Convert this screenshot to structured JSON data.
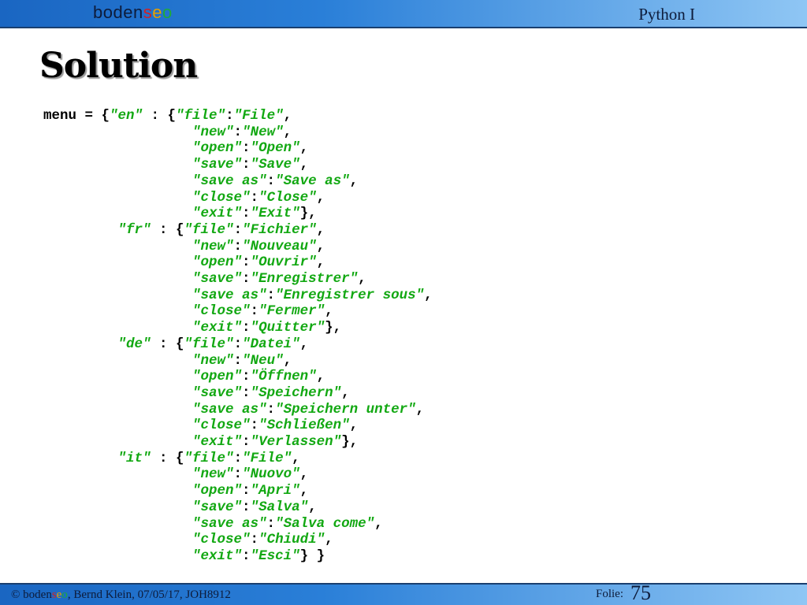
{
  "header": {
    "logo_text": "bodenseo",
    "course": "Python I"
  },
  "slide": {
    "title": "Solution"
  },
  "code": {
    "variable": "menu",
    "languages": [
      {
        "key": "en",
        "entries": [
          [
            "file",
            "File"
          ],
          [
            "new",
            "New"
          ],
          [
            "open",
            "Open"
          ],
          [
            "save",
            "Save"
          ],
          [
            "save as",
            "Save as"
          ],
          [
            "close",
            "Close"
          ],
          [
            "exit",
            "Exit"
          ]
        ]
      },
      {
        "key": "fr",
        "entries": [
          [
            "file",
            "Fichier"
          ],
          [
            "new",
            "Nouveau"
          ],
          [
            "open",
            "Ouvrir"
          ],
          [
            "save",
            "Enregistrer"
          ],
          [
            "save as",
            "Enregistrer sous"
          ],
          [
            "close",
            "Fermer"
          ],
          [
            "exit",
            "Quitter"
          ]
        ]
      },
      {
        "key": "de",
        "entries": [
          [
            "file",
            "Datei"
          ],
          [
            "new",
            "Neu"
          ],
          [
            "open",
            "Öffnen"
          ],
          [
            "save",
            "Speichern"
          ],
          [
            "save as",
            "Speichern unter"
          ],
          [
            "close",
            "Schließen"
          ],
          [
            "exit",
            "Verlassen"
          ]
        ]
      },
      {
        "key": "it",
        "entries": [
          [
            "file",
            "File"
          ],
          [
            "new",
            "Nuovo"
          ],
          [
            "open",
            "Apri"
          ],
          [
            "save",
            "Salva"
          ],
          [
            "save as",
            "Salva come"
          ],
          [
            "close",
            "Chiudi"
          ],
          [
            "exit",
            "Esci"
          ]
        ]
      }
    ]
  },
  "footer": {
    "copyright_symbol": "©",
    "brand": "bodenseo",
    "credit_rest": ", Bernd Klein, 07/05/17, JOH8912",
    "folie_label": "Folie:",
    "folie_number": "75"
  },
  "colors": {
    "bar_start": "#1a66c2",
    "bar_end": "#8fc6f4",
    "string_green": "#12a812"
  }
}
